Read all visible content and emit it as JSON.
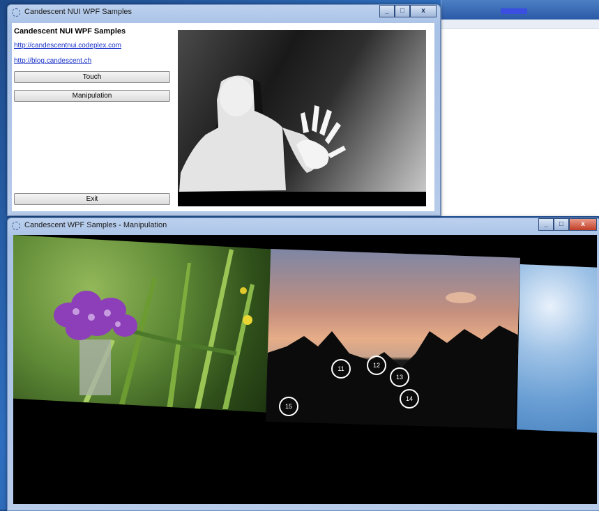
{
  "desktop": {
    "accent": "#2f6fbf"
  },
  "top_window": {
    "title": "Candescent NUI WPF Samples",
    "heading": "Candescent NUI WPF Samples",
    "links": [
      "http://candescentnui.codeplex.com",
      "http://blog.candescent.ch"
    ],
    "buttons": {
      "touch": "Touch",
      "manipulation": "Manipulation",
      "exit": "Exit"
    },
    "caption_buttons": {
      "minimize": "_",
      "maximize": "□",
      "close": "x"
    }
  },
  "bottom_window": {
    "title": "Candescent WPF Samples - Manipulation",
    "caption_buttons": {
      "minimize": "_",
      "maximize": "□",
      "close": "x"
    },
    "touch_points": [
      "11",
      "12",
      "13",
      "14",
      "15"
    ]
  },
  "icons": {
    "app_icon": "gear-ring-icon"
  }
}
